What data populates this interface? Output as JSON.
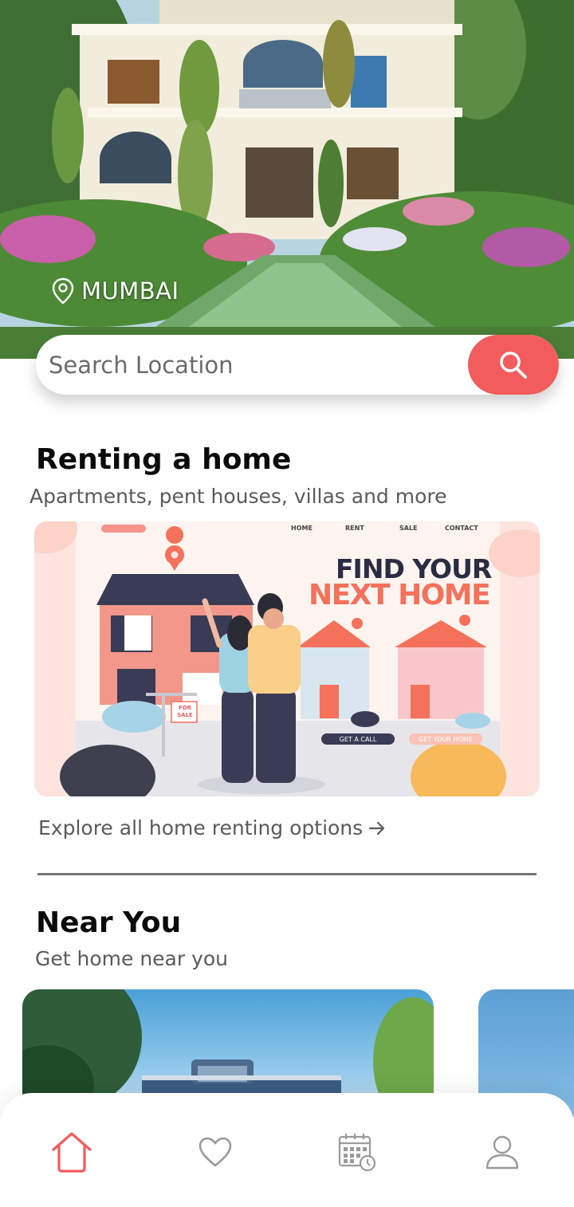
{
  "hero": {
    "location": "MUMBAI"
  },
  "search": {
    "placeholder": "Search Location"
  },
  "renting": {
    "title": "Renting a home",
    "subtitle": "Apartments, pent houses, villas and more",
    "banner": {
      "nav": [
        "HOME",
        "RENT",
        "SALE",
        "CONTACT"
      ],
      "headline_1": "FIND YOUR",
      "headline_2": "NEXT HOME",
      "button_1": "GET A CALL",
      "button_2": "GET YOUR HOME",
      "sign": "FOR SALE"
    },
    "explore_link": "Explore all home renting options"
  },
  "near": {
    "title": "Near You",
    "subtitle": "Get home near you"
  },
  "bottom_nav": {
    "items": [
      "home-icon",
      "heart-icon",
      "calendar-icon",
      "profile-icon"
    ],
    "active": "home-icon"
  },
  "colors": {
    "accent": "#f25c5c",
    "text_dark": "#0b0b0b",
    "text_muted": "#5a5a5a"
  }
}
